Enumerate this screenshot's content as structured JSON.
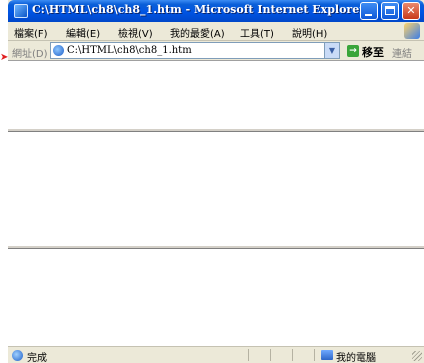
{
  "window": {
    "title": "C:\\HTML\\ch8\\ch8_1.htm - Microsoft Internet Explorer"
  },
  "menubar": {
    "items": [
      {
        "label": "檔案(F)"
      },
      {
        "label": "編輯(E)"
      },
      {
        "label": "檢視(V)"
      },
      {
        "label": "我的最愛(A)"
      },
      {
        "label": "工具(T)"
      },
      {
        "label": "說明(H)"
      }
    ]
  },
  "addressbar": {
    "label": "網址(D)",
    "value": "C:\\HTML\\ch8\\ch8_1.htm",
    "go_label": "移至",
    "links_label": "連結"
  },
  "content": {
    "frame_count": 3
  },
  "statusbar": {
    "status": "完成",
    "zone": "我的電腦"
  },
  "icons": {
    "app": "ie-icon",
    "page": "page-icon",
    "go": "go-arrow-icon",
    "status": "done-icon",
    "zone": "my-computer-icon"
  },
  "colors": {
    "titlebar": "#0054e3",
    "chrome": "#ece9d8",
    "close_button": "#c8391a",
    "pointer": "#e02020"
  }
}
